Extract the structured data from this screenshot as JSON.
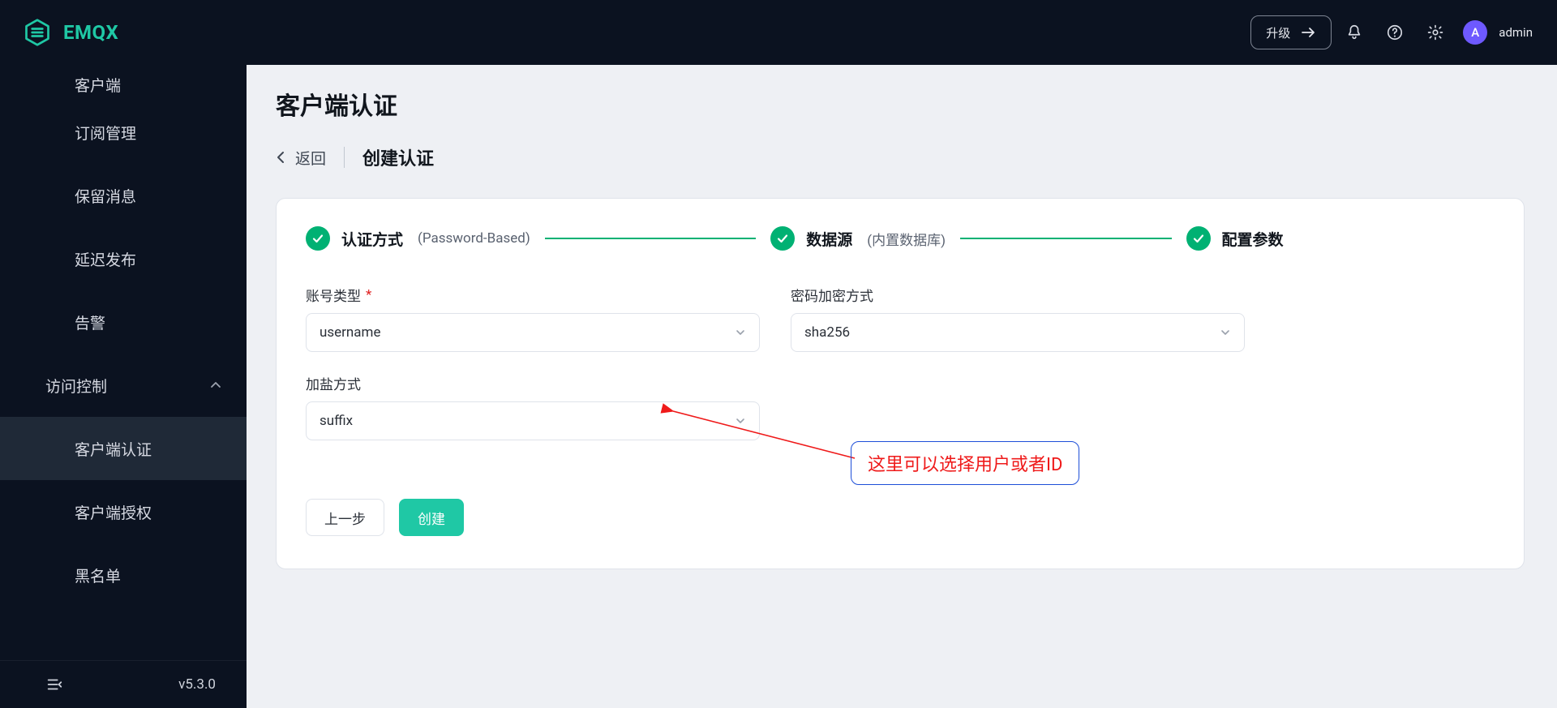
{
  "brand": {
    "name": "EMQX"
  },
  "header": {
    "upgrade_label": "升级",
    "user_initial": "A",
    "user_name": "admin"
  },
  "sidebar": {
    "items": [
      {
        "id": "clients",
        "label": "客户端",
        "truncated": true
      },
      {
        "id": "subscriptions",
        "label": "订阅管理"
      },
      {
        "id": "retained",
        "label": "保留消息"
      },
      {
        "id": "delayed",
        "label": "延迟发布"
      },
      {
        "id": "alarms",
        "label": "告警"
      }
    ],
    "section": {
      "label": "访问控制",
      "expanded": true
    },
    "section_items": [
      {
        "id": "authn",
        "label": "客户端认证",
        "active": true
      },
      {
        "id": "authz",
        "label": "客户端授权"
      },
      {
        "id": "banned",
        "label": "黑名单"
      }
    ],
    "version": "v5.3.0"
  },
  "page": {
    "title": "客户端认证",
    "back_label": "返回",
    "breadcrumb_current": "创建认证"
  },
  "steps": [
    {
      "title": "认证方式",
      "sub": "(Password-Based)"
    },
    {
      "title": "数据源",
      "sub": "(内置数据库)"
    },
    {
      "title": "配置参数",
      "sub": ""
    }
  ],
  "form": {
    "account_type": {
      "label": "账号类型",
      "required": true,
      "value": "username"
    },
    "hash": {
      "label": "密码加密方式",
      "required": false,
      "value": "sha256"
    },
    "salt": {
      "label": "加盐方式",
      "required": false,
      "value": "suffix"
    }
  },
  "actions": {
    "prev": "上一步",
    "create": "创建"
  },
  "annotation": {
    "text": "这里可以选择用户或者ID"
  }
}
